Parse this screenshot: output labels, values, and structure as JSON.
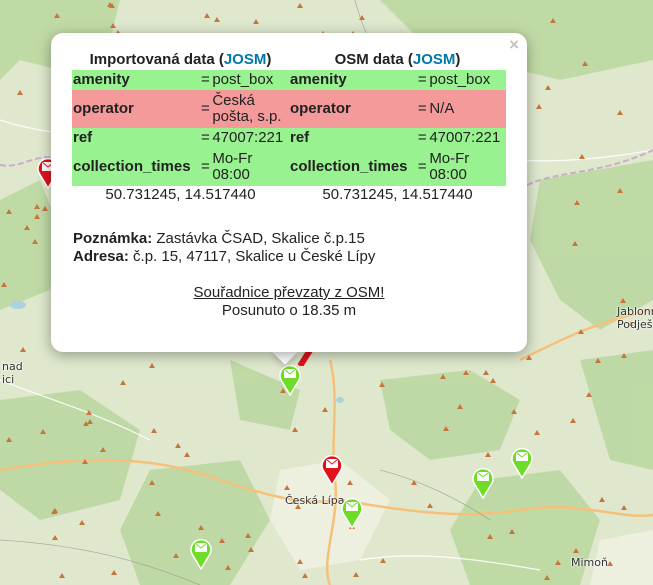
{
  "map": {
    "towns": [
      {
        "id": "ceska-lipa",
        "label": "Česká Lípa"
      },
      {
        "id": "jablonne",
        "label": "Jablonné"
      },
      {
        "id": "podjested",
        "label": "Podještědí"
      },
      {
        "id": "mimon",
        "label": "Mimoň"
      },
      {
        "id": "nad",
        "label": "nad"
      },
      {
        "id": "ici",
        "label": "ici"
      }
    ],
    "colors": {
      "land": "#dfe8cd",
      "forest": "#b9d79e",
      "road": "#f6b86e",
      "border": "#c8a0c8",
      "marker_green": "#6fdc28",
      "marker_red": "#e0121b",
      "peak": "#c7753d"
    }
  },
  "popup": {
    "close_label": "×",
    "imported_title_prefix": "Importovaná data (",
    "osm_title_prefix": "OSM data (",
    "josm_label": "JOSM",
    "title_suffix": ")",
    "rows": [
      {
        "key": "amenity",
        "imported": "post_box",
        "osm": "post_box",
        "status": "match"
      },
      {
        "key": "operator",
        "imported_line1": "Česká",
        "imported_line2": "pošta, s.p.",
        "osm": "N/A",
        "status": "mismatch"
      },
      {
        "key": "ref",
        "imported": "47007:221",
        "osm": "47007:221",
        "status": "match"
      },
      {
        "key": "collection_times",
        "imported_line1": "Mo-Fr",
        "imported_line2": "08:00",
        "osm_line1": "Mo-Fr",
        "osm_line2": "08:00",
        "status": "match"
      }
    ],
    "eq_sign": "=",
    "imported_coords": "50.731245, 14.517440",
    "osm_coords": "50.731245, 14.517440",
    "note_label": "Poznámka:",
    "note_text": " Zastávka ČSAD, Skalice č.p.15",
    "address_label": "Adresa:",
    "address_text": " č.p. 15, 47117, Skalice u České Lípy",
    "coords_taken_link": "Souřadnice převzaty z OSM!",
    "moved_text": "Posunuto o 18.35 m"
  }
}
